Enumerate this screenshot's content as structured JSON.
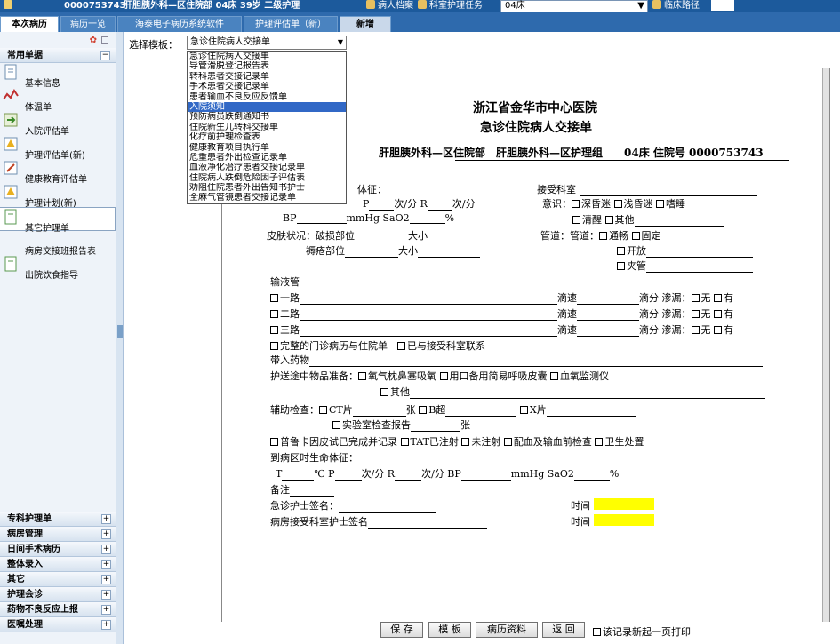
{
  "header": {
    "patient_id": "0000753743",
    "patient_info": "肝胆胰外科—区住院部 04床 39岁 二级护理",
    "links": [
      "病人档案",
      "科室护理任务"
    ],
    "bed_value": "04床 ",
    "clinical_path": "临床路径"
  },
  "tabs": [
    "本次病历",
    "病历一览",
    "海泰电子病历系统软件",
    "护理评估单（新）",
    "新增"
  ],
  "sidebar": {
    "common_title": "常用单据",
    "items": [
      "基本信息",
      "体温单",
      "入院评估单",
      "护理评估单(新)",
      "健康教育评估单",
      "护理计划(新)",
      "其它护理单",
      "病房交接班报告表",
      "出院饮食指导"
    ],
    "bottom": [
      "专科护理单",
      "病房管理",
      "日间手术病历",
      "整体录入",
      "其它",
      "护理会诊",
      "药物不良反应上报",
      "医嘱处理"
    ]
  },
  "template": {
    "label": "选择模板：",
    "selected": "急诊住院病人交接单",
    "options": [
      "急诊住院病人交接单",
      "导管滑脱登记报告表",
      "转科患者交接记录单",
      "手术患者交接记录单",
      "患者输血不良反应反馈单",
      "入院须知",
      "预防病员跌倒通知书",
      "住院新生儿转科交接单",
      "化疗前护理检查表",
      "健康教育项目执行单",
      "危重患者外出检查记录单",
      "血液净化治疗患者交接记录单",
      "住院病人跌倒危险因子评估表",
      "劝阻住院患者外出告知书护士",
      "全麻气管镜患者交接记录单"
    ],
    "highlighted": 5
  },
  "doc": {
    "hospital": "浙江省金华市中心医院",
    "title": "急诊住院病人交接单",
    "dept_line": "肝胆胰外科—区住院部　肝胆胰外科—区护理组　　04床 住院号 0000753743",
    "vital_label": "体征：",
    "receive_dept": "接受科室",
    "pulse_a": "P",
    "per_min": "次/分",
    "resp": "R",
    "consciousness": "意识：",
    "deep_coma": "深昏迷",
    "light_coma": "浅昏迷",
    "lethargy": "嗜睡",
    "bp": "BP",
    "mmhg": "mmHg",
    "sao2": "SaO2",
    "percent": "%",
    "alert": "清醒",
    "other": "其他",
    "skin": "皮肤状况：",
    "broken": "破损部位",
    "size": "大小",
    "pressure": "褥疮部位",
    "tube_lbl": "管道：",
    "tube_lbl2": "管道：",
    "clear": "通畅",
    "fixed": "固定",
    "open": "开放",
    "clamped": "夹管",
    "iv": "输液管",
    "line1": "一路",
    "line2": "二路",
    "line3": "三路",
    "drip": "滴速",
    "drops": "滴分",
    "leak": "渗漏：",
    "none": "无",
    "yes": "有",
    "records": "完整的门诊病历与住院单",
    "contacted": "已与接受科室联系",
    "meds": "带入药物",
    "prep": "护送途中物品准备：",
    "oxygen": "氧气枕鼻塞吸氧",
    "bag": "用口备用简易呼吸皮囊",
    "spo2": "血氧监测仪",
    "prep_other": "其他",
    "aux": "辅助检查：",
    "ct": "CT片",
    "sheets": "张",
    "bus": "B超",
    "xray": "X片",
    "lab": "实验室检查报告",
    "skin_test": "普鲁卡因皮试已完成并记录",
    "tat": "TAT已注射",
    "no_inject": "未注射",
    "match": "配血及输血前检查",
    "sanitary": "卫生处置",
    "arrive": "到病区时生命体征：",
    "t": "T",
    "celsius": "℃",
    "remark": "备注",
    "er_sign": "急诊护士签名：",
    "ward_sign": "病房接受科室护士签名",
    "time": "时间"
  },
  "buttons": [
    "保 存",
    "模 板",
    "病历资料",
    "返 回"
  ],
  "print_option": "该记录新起一页打印"
}
